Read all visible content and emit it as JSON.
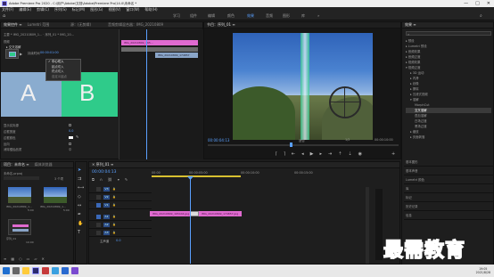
{
  "title_bar": {
    "title": "Adobe Premiere Pro 2020 - C:\\用户\\Adobe\\文档\\Adobe\\Premiere Pro\\14.0\\未命名 *",
    "minimize": "—",
    "maximize": "□",
    "close": "✕"
  },
  "menubar": {
    "items": [
      "文件(F)",
      "编辑(E)",
      "剪辑(C)",
      "序列(S)",
      "标记(M)",
      "图形(G)",
      "视图(V)",
      "窗口(W)",
      "帮助(H)"
    ]
  },
  "workspaces": {
    "items": [
      "学习",
      "组件",
      "编辑",
      "颜色",
      "效果",
      "音频",
      "图形",
      "库"
    ],
    "active": "效果",
    "more": "»"
  },
  "effect_controls": {
    "tabs": [
      "效果控件 ≡",
      "Lumetri 范围",
      "源：(无剪辑)",
      "音频剪辑混合器：IMG_20210809"
    ],
    "row_master": "主要 * IMG_20210809_1...  ·  序列_01 * IMG_20...",
    "row_video": "视频",
    "row_transition": "▸ 交叉溶解",
    "fields": [
      "持续时间",
      "对齐",
      "开始：",
      "结束：",
      "显示实际源",
      "边框宽度",
      "边框颜色",
      "反向",
      "消除锯齿品质"
    ],
    "duration_value": "00:00:01:00",
    "border_width": "0.0",
    "antialias": "中",
    "letter_a": "A",
    "letter_b": "B",
    "dropdown_items": [
      "中心切入",
      "起点切入",
      "终点切入",
      "自定义起点"
    ],
    "dropdown_selected": "中心切入",
    "mini_tl_clip_a": "IMG_20210809_165...",
    "mini_tl_clip_b": "IMG_20210809_174857"
  },
  "program_monitor": {
    "title": "节目：序列_01 ≡",
    "timecode_left": "00:00:04:13",
    "fit": "适合",
    "quality": "1/2",
    "timecode_right": "00:00:10:00"
  },
  "effects_panel": {
    "tab": "效果 ≡",
    "search_placeholder": "",
    "tree": [
      "▸ 预设",
      "▸ Lumetri 预设",
      "▸ 音频效果",
      "▸ 音频过渡",
      "▸ 视频效果",
      "▾ 视频过渡",
      "▸ 3D 运动",
      "▸ 内滑",
      "▸ 划像",
      "▸ 擦除",
      "▸ 沉浸式视频",
      "▾ 溶解",
      "MorphCut",
      "交叉溶解",
      "叠加溶解",
      "白场过渡",
      "黑场过渡",
      "▸ 缩放",
      "▸ 页面剥落"
    ],
    "bottom_items": [
      "基本图形",
      "基本声音",
      "Lumetri 颜色",
      "库",
      "标记",
      "历史记录",
      "信息"
    ]
  },
  "project_panel": {
    "tabs": [
      "项目：未命名 ≡",
      "媒体浏览器"
    ],
    "project_name": "未命名.prproj",
    "items_count": "3 个项",
    "items": [
      {
        "name": "IMG_20210809_1...",
        "dur": "5:00"
      },
      {
        "name": "IMG_20210809_1...",
        "dur": "5:00"
      },
      {
        "name": "序列_01",
        "dur": "10:00"
      }
    ]
  },
  "timeline": {
    "title": "× 序列_01 ≡",
    "timecode": "00:00:04:13",
    "ruler": [
      "00:00",
      "00:00:05:00",
      "00:00:10:00",
      "00:00:15:00"
    ],
    "tracks_video": [
      "V3",
      "V2",
      "V1"
    ],
    "tracks_audio": [
      "A1",
      "A2",
      "A3"
    ],
    "master": "主声道",
    "master_value": "0.0",
    "clip_a": "IMG_20210809_165444.jpg",
    "clip_b": "IMG_20210809_174857.jpg"
  },
  "taskbar": {
    "time": "19:05",
    "date": "2021/8/28"
  },
  "watermark": "最需教育",
  "colors": {
    "accent": "#5aa0ff",
    "clip": "#e06ad0",
    "transition_a_bg": "#8aaccf",
    "transition_b_bg": "#2fcb8a"
  }
}
